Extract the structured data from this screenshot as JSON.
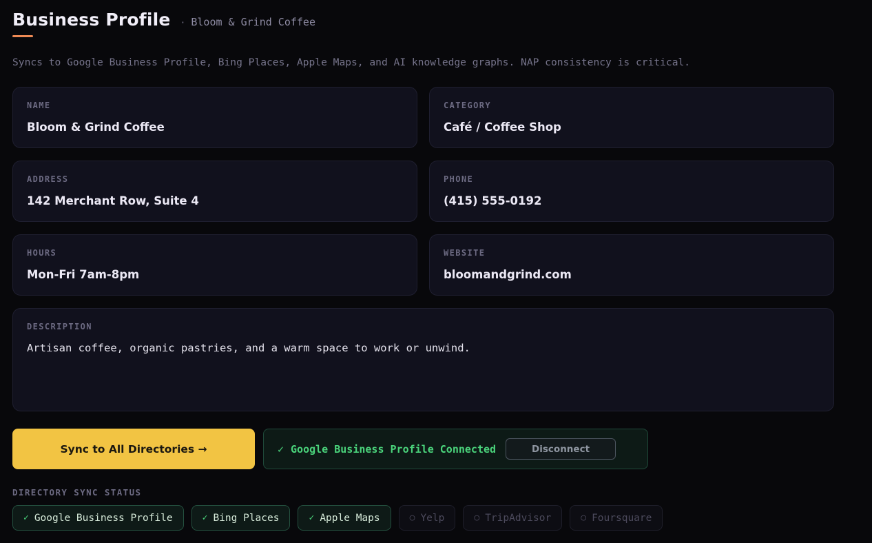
{
  "header": {
    "title": "Business Profile",
    "separator": "·",
    "subtitle": "Bloom & Grind Coffee",
    "intro": "Syncs to Google Business Profile, Bing Places, Apple Maps, and AI knowledge graphs. NAP consistency is critical."
  },
  "fields": {
    "name": {
      "label": "NAME",
      "value": "Bloom & Grind Coffee"
    },
    "category": {
      "label": "CATEGORY",
      "value": "Café / Coffee Shop"
    },
    "address": {
      "label": "ADDRESS",
      "value": "142 Merchant Row, Suite 4"
    },
    "phone": {
      "label": "PHONE",
      "value": "(415) 555-0192"
    },
    "hours": {
      "label": "HOURS",
      "value": "Mon-Fri 7am-8pm"
    },
    "website": {
      "label": "WEBSITE",
      "value": "bloomandgrind.com"
    },
    "description": {
      "label": "DESCRIPTION",
      "value": "Artisan coffee, organic pastries, and a warm space to work or unwind."
    }
  },
  "actions": {
    "sync_label": "Sync to All Directories →",
    "connected_check": "✓",
    "connected_text": "Google Business Profile Connected",
    "disconnect_label": "Disconnect"
  },
  "directory": {
    "label": "DIRECTORY SYNC STATUS",
    "items": [
      {
        "name": "Google Business Profile",
        "icon": "✓",
        "status": "synced"
      },
      {
        "name": "Bing Places",
        "icon": "✓",
        "status": "synced"
      },
      {
        "name": "Apple Maps",
        "icon": "✓",
        "status": "synced"
      },
      {
        "name": "Yelp",
        "icon": "○",
        "status": "not-synced"
      },
      {
        "name": "TripAdvisor",
        "icon": "○",
        "status": "not-synced"
      },
      {
        "name": "Foursquare",
        "icon": "○",
        "status": "not-synced"
      }
    ]
  },
  "colors": {
    "background": "#08080b",
    "accent": "#ee8a55",
    "primary_button": "#f2c443",
    "success": "#4ad37b"
  }
}
